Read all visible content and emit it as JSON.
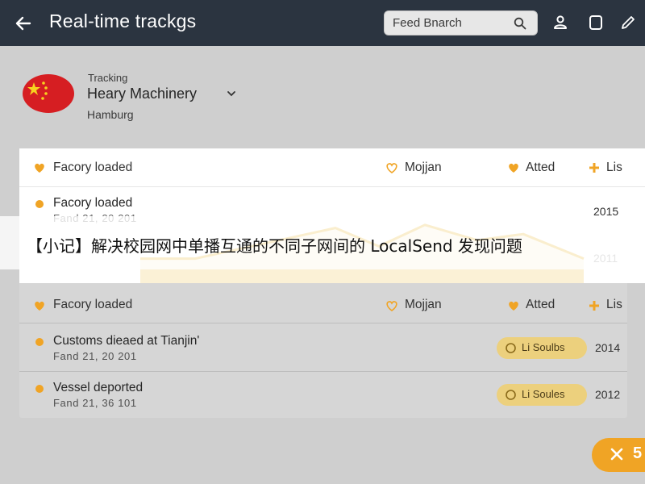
{
  "header": {
    "title": "Real-time trackgs",
    "search_placeholder": "Feed Bnarch",
    "icons": [
      "back-arrow-icon",
      "search-icon",
      "user-icon",
      "square-icon",
      "pen-icon"
    ]
  },
  "shipment": {
    "tracking_label": "Tracking",
    "company": "Heary Machinery",
    "city": "Hamburg",
    "flag_icon": "china-flag-icon"
  },
  "table_header": {
    "col1": "Facory loaded",
    "col2": "Mojjan",
    "col3": "Atted",
    "col4": "Lis"
  },
  "card_events": [
    {
      "title": "Facory loaded",
      "subtitle": "Fand 21, 20 201",
      "year": "2015"
    }
  ],
  "card_extra_year": "2011",
  "chart_data": {
    "type": "area",
    "values": [
      4,
      4,
      9,
      6,
      9.5,
      7,
      8,
      4
    ]
  },
  "events": [
    {
      "title": "Customs dieaed at Tianjin'",
      "subtitle": "Fand 21, 20 201",
      "badge": "Li Soulbs",
      "year": "2014"
    },
    {
      "title": "Vessel deported",
      "subtitle": "Fand 21, 36 101",
      "badge": "Li Soules",
      "year": "2012"
    }
  ],
  "banner": {
    "text": "【小记】解决校园网中单播互通的不同子网间的 LocalSend 发现问题"
  },
  "fab": {
    "label": "5"
  },
  "colors": {
    "topbar": "#2b3440",
    "accent": "#f0a425",
    "chip_bg": "#ecd07d",
    "background": "#cfcfcf",
    "flag_red": "#d61e22",
    "chart_line": "#e8b020"
  }
}
